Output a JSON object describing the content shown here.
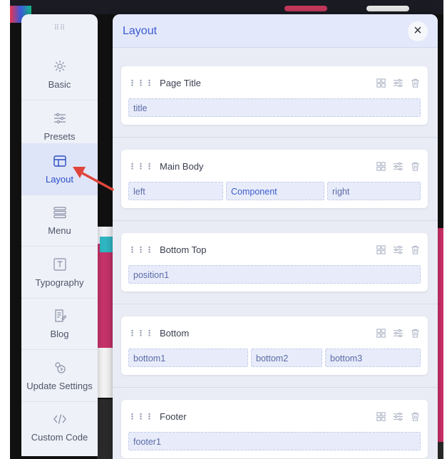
{
  "sidebar": {
    "items": [
      {
        "label": "Basic",
        "icon": "gear-icon"
      },
      {
        "label": "Presets",
        "icon": "sliders-icon"
      },
      {
        "label": "Layout",
        "icon": "layout-icon"
      },
      {
        "label": "Menu",
        "icon": "menu-icon"
      },
      {
        "label": "Typography",
        "icon": "typography-icon"
      },
      {
        "label": "Blog",
        "icon": "blog-icon"
      },
      {
        "label": "Update Settings",
        "icon": "update-icon"
      },
      {
        "label": "Custom Code",
        "icon": "code-icon"
      }
    ],
    "active": "Layout"
  },
  "panel": {
    "title": "Layout",
    "close": "×",
    "rows": [
      {
        "title": "Page Title",
        "slots": [
          "title"
        ]
      },
      {
        "title": "Main Body",
        "slots": [
          "left",
          "Component",
          "right"
        ]
      },
      {
        "title": "Bottom Top",
        "slots": [
          "position1"
        ]
      },
      {
        "title": "Bottom",
        "slots": [
          "bottom1",
          "bottom2",
          "bottom3"
        ]
      },
      {
        "title": "Footer",
        "slots": [
          "footer1"
        ]
      }
    ]
  },
  "colors": {
    "accent": "#3b5bd0",
    "arrow": "#e0453c",
    "active_bg": "#dfe5f8"
  }
}
